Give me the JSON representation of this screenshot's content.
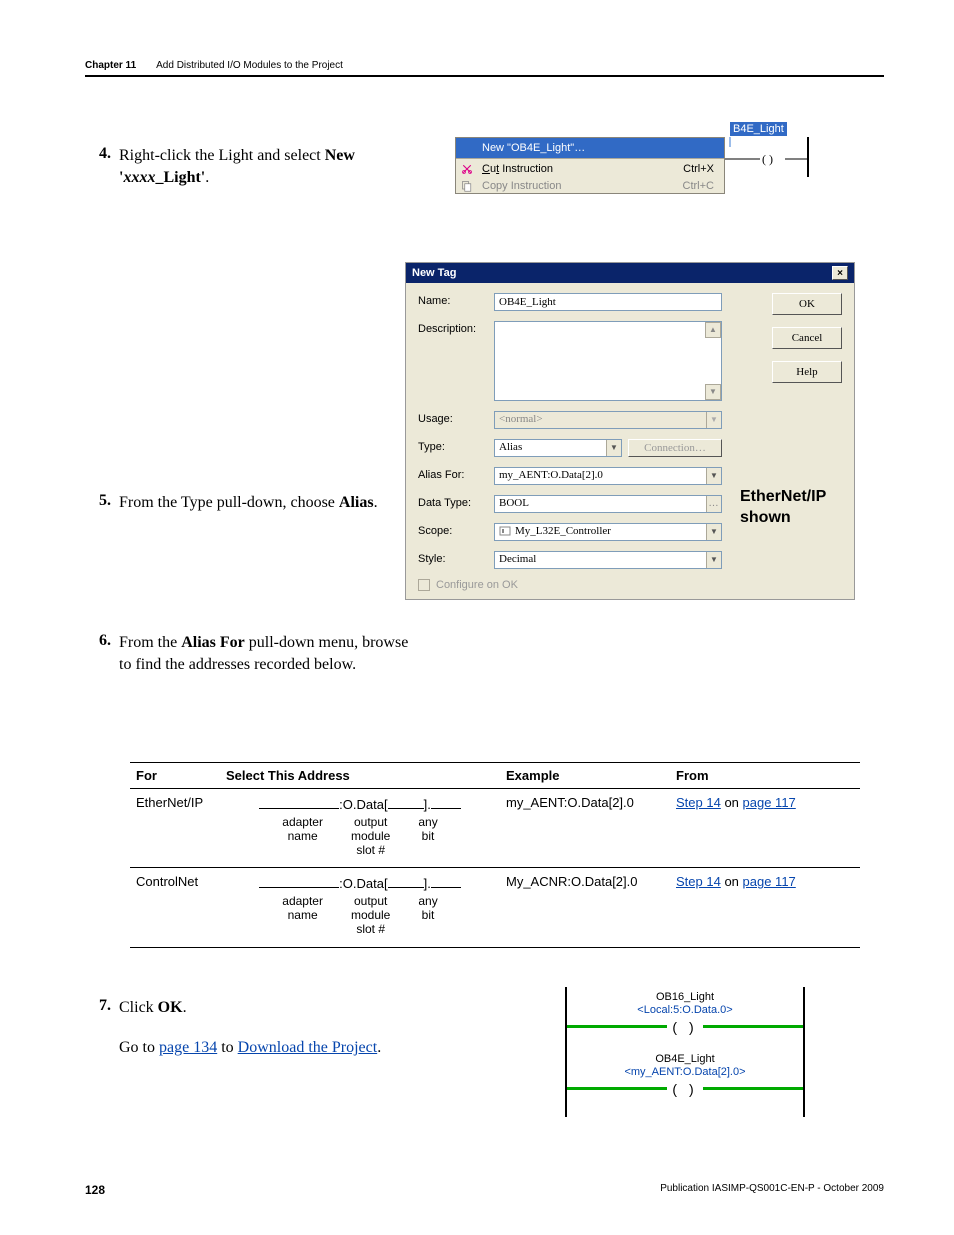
{
  "header": {
    "chapter": "Chapter 11",
    "title": "Add Distributed I/O Modules to the Project"
  },
  "steps": {
    "s4": {
      "num": "4.",
      "a": "Right-click the Light and select ",
      "b": "New '",
      "c": "xxxx",
      "d": "_Light'",
      "e": "."
    },
    "s5": {
      "num": "5.",
      "a": "From the Type pull-down, choose ",
      "b": "Alias",
      "c": "."
    },
    "s6": {
      "num": "6.",
      "a": "From the ",
      "b": "Alias For",
      "c": " pull-down menu, browse to find the addresses recorded below."
    },
    "s7": {
      "num": "7.",
      "a": "Click ",
      "b": "OK",
      "c": "."
    },
    "s8": {
      "a": "Go to ",
      "link1": "page 134",
      "b": " to ",
      "link2": "Download the Project",
      "c": "."
    }
  },
  "ctx": {
    "ladder_tag": "B4E_Light",
    "new_item": "New \"OB4E_Light\"…",
    "cut": "Cut Instruction",
    "cut_key": "Ctrl+X",
    "copy": "Copy Instruction",
    "copy_key": "Ctrl+C"
  },
  "dialog": {
    "title": "New Tag",
    "labels": {
      "name": "Name:",
      "desc": "Description:",
      "usage": "Usage:",
      "type": "Type:",
      "aliasfor": "Alias For:",
      "datatype": "Data Type:",
      "scope": "Scope:",
      "style": "Style:"
    },
    "values": {
      "name": "OB4E_Light",
      "usage": "<normal>",
      "type": "Alias",
      "connection": "Connection…",
      "aliasfor": "my_AENT:O.Data[2].0",
      "datatype": "BOOL",
      "scope": "My_L32E_Controller",
      "style": "Decimal",
      "configure": "Configure on OK"
    },
    "buttons": {
      "ok": "OK",
      "cancel": "Cancel",
      "help": "Help"
    }
  },
  "annotation": {
    "l1": "EtherNet/IP",
    "l2": "shown"
  },
  "table": {
    "headers": {
      "for": "For",
      "select": "Select This Address",
      "example": "Example",
      "from": "From"
    },
    "rows": [
      {
        "for": "EtherNet/IP",
        "pattern_mid": ":O.Data[",
        "pattern_end": "].",
        "col1": {
          "a": "adapter",
          "b": "name"
        },
        "col2": {
          "a": "output",
          "b": "module",
          "c": "slot #"
        },
        "col3": {
          "a": "any",
          "b": "bit"
        },
        "example": "my_AENT:O.Data[2].0",
        "from_step": "Step 14",
        "from_on": " on ",
        "from_page": "page 117"
      },
      {
        "for": "ControlNet",
        "pattern_mid": ":O.Data[",
        "pattern_end": "].",
        "col1": {
          "a": "adapter",
          "b": "name"
        },
        "col2": {
          "a": "output",
          "b": "module",
          "c": "slot #"
        },
        "col3": {
          "a": "any",
          "b": "bit"
        },
        "example": "My_ACNR:O.Data[2].0",
        "from_step": "Step 14",
        "from_on": " on ",
        "from_page": "page 117"
      }
    ]
  },
  "ladder": {
    "r1": {
      "name": "OB16_Light",
      "alias": "<Local:5:O.Data.0>"
    },
    "r2": {
      "name": "OB4E_Light",
      "alias": "<my_AENT:O.Data[2].0>"
    }
  },
  "footer": {
    "page": "128",
    "pub": "Publication IASIMP-QS001C-EN-P - October 2009"
  }
}
